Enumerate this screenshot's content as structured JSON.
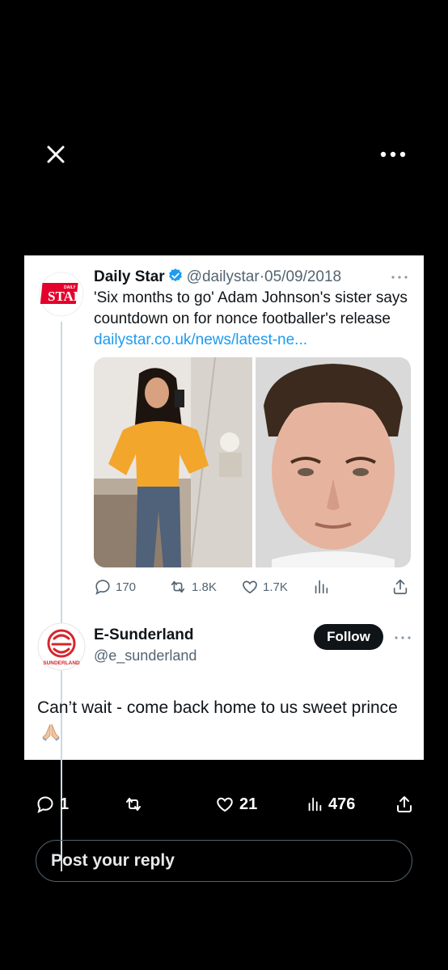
{
  "header": {
    "close_icon": "close-icon",
    "more_icon": "more-horizontal-icon"
  },
  "quoted_tweet": {
    "author_name": "Daily Star",
    "verified": true,
    "handle": "@dailystar",
    "separator": "·",
    "date": "05/09/2018",
    "text": "'Six months to go' Adam Johnson's sister says countdown on for nonce footballer's release",
    "link_text": "dailystar.co.uk/news/latest-ne...",
    "avatar_logo": {
      "top": "DAILY",
      "main": "STAR",
      "color": "#e4002b"
    },
    "images": [
      {
        "name": "woman-selfie-photo",
        "colors": {
          "top": "#ece9e6",
          "shirt": "#f3a62c",
          "jeans": "#50617a"
        }
      },
      {
        "name": "man-mugshot-photo",
        "colors": {
          "bg": "#d9d9d9",
          "skin": "#e6b49e",
          "hair": "#3b2a1d"
        }
      }
    ],
    "stats": {
      "replies": "170",
      "reposts": "1.8K",
      "likes": "1.7K"
    }
  },
  "reply_tweet": {
    "author_name": "E-Sunderland",
    "handle": "@e_sunderland",
    "follow_label": "Follow",
    "text": "Can’t wait - come back home to us sweet prince",
    "emoji": "folded-hands-emoji",
    "avatar_logo": {
      "text": "SUNDERLAND",
      "color": "#d6262c"
    }
  },
  "bottom_stats": {
    "replies": "1",
    "reposts": "",
    "likes": "21",
    "views": "476"
  },
  "reply_input": {
    "placeholder": "Post your reply"
  },
  "colors": {
    "accent": "#1d9bf0",
    "text_primary": "#0f1419",
    "text_secondary": "#536471",
    "background": "#000000",
    "card": "#ffffff"
  }
}
